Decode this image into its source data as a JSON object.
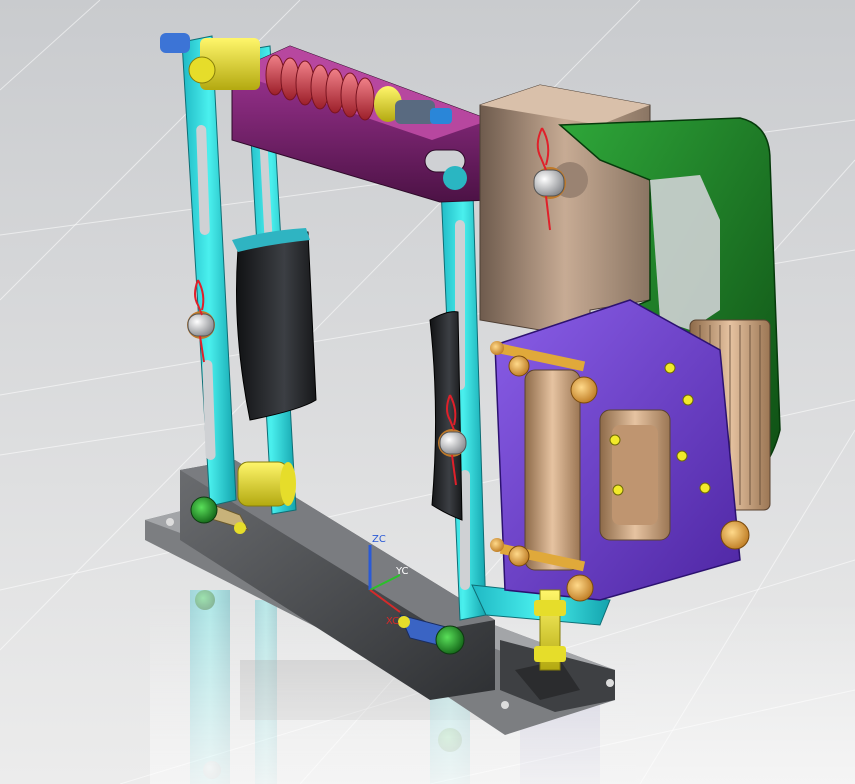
{
  "viewport": {
    "title": "",
    "colors": {
      "frame": "#33d6d6",
      "arm": "#7a1f6e",
      "spring": "#d6454f",
      "bracket": "#c7a98e",
      "green_arm": "#1f7a1f",
      "purple_plate": "#6a3dc4",
      "coil": "#c79a6e",
      "base": "#4d4f52",
      "shoe": "#2a2c2f",
      "roller": "#e6e019",
      "bolt": "#e0a93a"
    }
  },
  "triad": {
    "z_label": "ZC",
    "y_label": "YC",
    "x_label": "XC"
  }
}
